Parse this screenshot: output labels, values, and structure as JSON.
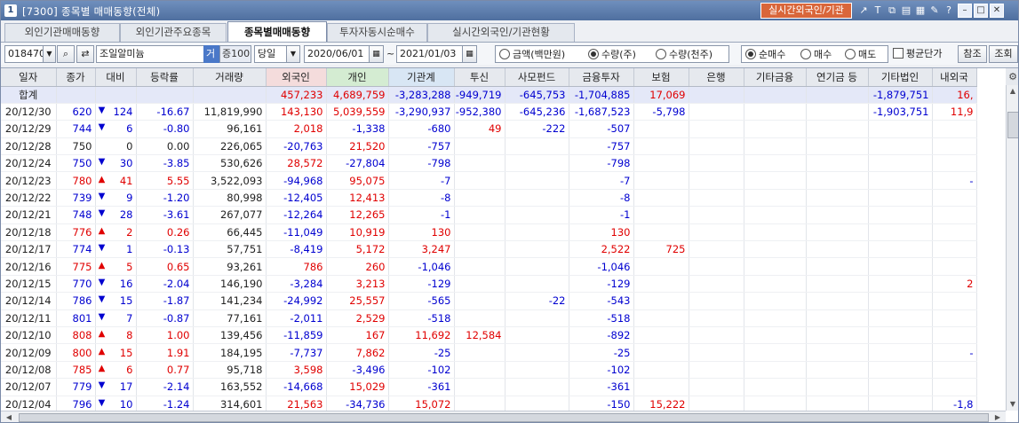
{
  "window": {
    "title": "[7300] 종목별 매매동향(전체)",
    "app_icon": "1",
    "live_button": "실시간외국인/기관"
  },
  "tabs": [
    {
      "label": "외인기관매매동향",
      "active": false
    },
    {
      "label": "외인기관주요종목",
      "active": false
    },
    {
      "label": "종목별매매동향",
      "active": true
    },
    {
      "label": "투자자동시순매수",
      "active": false
    },
    {
      "label": "실시간외국인/기관현황",
      "active": false
    }
  ],
  "toolbar": {
    "code": "018470",
    "stock_name": "조일알미늄",
    "badge_geo": "거",
    "badge_pct": "증100",
    "period": "당일",
    "date_from": "2020/06/01",
    "date_sep": "~",
    "date_to": "2021/01/03",
    "unit_options": [
      "금액(백만원)",
      "수량(주)",
      "수량(천주)"
    ],
    "unit_selected": 1,
    "type_options": [
      "순매수",
      "매수",
      "매도"
    ],
    "type_selected": 0,
    "avg_price_label": "평균단가",
    "ref_button": "참조",
    "query_button": "조회"
  },
  "table": {
    "columns": [
      "일자",
      "종가",
      "대비",
      "등락률",
      "거래량",
      "외국인",
      "개인",
      "기관계",
      "투신",
      "사모펀드",
      "금융투자",
      "보험",
      "은행",
      "기타금융",
      "연기금 등",
      "기타법인",
      "내외국"
    ],
    "summary": {
      "label": "합계",
      "cells": [
        "",
        "",
        "",
        "",
        "457,233",
        "4,689,759",
        "-3,283,288",
        "-949,719",
        "-645,753",
        "-1,704,885",
        "17,069",
        "",
        "",
        "",
        "-1,879,751",
        "16,"
      ]
    },
    "rows": [
      {
        "date": "20/12/30",
        "close": "620",
        "dir": "down",
        "chg": "124",
        "rate": "-16.67",
        "vol": "11,819,990",
        "inv": [
          "143,130",
          "5,039,559",
          "-3,290,937",
          "-952,380",
          "-645,236",
          "-1,687,523",
          "-5,798",
          "",
          "",
          "",
          "-1,903,751",
          "11,9"
        ]
      },
      {
        "date": "20/12/29",
        "close": "744",
        "dir": "down",
        "chg": "6",
        "rate": "-0.80",
        "vol": "96,161",
        "inv": [
          "2,018",
          "-1,338",
          "-680",
          "49",
          "-222",
          "-507",
          "",
          "",
          "",
          "",
          "",
          ""
        ]
      },
      {
        "date": "20/12/28",
        "close": "750",
        "dir": "flat",
        "chg": "0",
        "rate": "0.00",
        "vol": "226,065",
        "inv": [
          "-20,763",
          "21,520",
          "-757",
          "",
          "",
          "-757",
          "",
          "",
          "",
          "",
          "",
          ""
        ]
      },
      {
        "date": "20/12/24",
        "close": "750",
        "dir": "down",
        "chg": "30",
        "rate": "-3.85",
        "vol": "530,626",
        "inv": [
          "28,572",
          "-27,804",
          "-798",
          "",
          "",
          "-798",
          "",
          "",
          "",
          "",
          "",
          ""
        ]
      },
      {
        "date": "20/12/23",
        "close": "780",
        "dir": "up",
        "chg": "41",
        "rate": "5.55",
        "vol": "3,522,093",
        "inv": [
          "-94,968",
          "95,075",
          "-7",
          "",
          "",
          "-7",
          "",
          "",
          "",
          "",
          "",
          "-"
        ]
      },
      {
        "date": "20/12/22",
        "close": "739",
        "dir": "down",
        "chg": "9",
        "rate": "-1.20",
        "vol": "80,998",
        "inv": [
          "-12,405",
          "12,413",
          "-8",
          "",
          "",
          "-8",
          "",
          "",
          "",
          "",
          "",
          ""
        ]
      },
      {
        "date": "20/12/21",
        "close": "748",
        "dir": "down",
        "chg": "28",
        "rate": "-3.61",
        "vol": "267,077",
        "inv": [
          "-12,264",
          "12,265",
          "-1",
          "",
          "",
          "-1",
          "",
          "",
          "",
          "",
          "",
          ""
        ]
      },
      {
        "date": "20/12/18",
        "close": "776",
        "dir": "up",
        "chg": "2",
        "rate": "0.26",
        "vol": "66,445",
        "inv": [
          "-11,049",
          "10,919",
          "130",
          "",
          "",
          "130",
          "",
          "",
          "",
          "",
          "",
          ""
        ]
      },
      {
        "date": "20/12/17",
        "close": "774",
        "dir": "down",
        "chg": "1",
        "rate": "-0.13",
        "vol": "57,751",
        "inv": [
          "-8,419",
          "5,172",
          "3,247",
          "",
          "",
          "2,522",
          "725",
          "",
          "",
          "",
          "",
          ""
        ]
      },
      {
        "date": "20/12/16",
        "close": "775",
        "dir": "up",
        "chg": "5",
        "rate": "0.65",
        "vol": "93,261",
        "inv": [
          "786",
          "260",
          "-1,046",
          "",
          "",
          "-1,046",
          "",
          "",
          "",
          "",
          "",
          ""
        ]
      },
      {
        "date": "20/12/15",
        "close": "770",
        "dir": "down",
        "chg": "16",
        "rate": "-2.04",
        "vol": "146,190",
        "inv": [
          "-3,284",
          "3,213",
          "-129",
          "",
          "",
          "-129",
          "",
          "",
          "",
          "",
          "",
          "2"
        ]
      },
      {
        "date": "20/12/14",
        "close": "786",
        "dir": "down",
        "chg": "15",
        "rate": "-1.87",
        "vol": "141,234",
        "inv": [
          "-24,992",
          "25,557",
          "-565",
          "",
          "-22",
          "-543",
          "",
          "",
          "",
          "",
          "",
          ""
        ]
      },
      {
        "date": "20/12/11",
        "close": "801",
        "dir": "down",
        "chg": "7",
        "rate": "-0.87",
        "vol": "77,161",
        "inv": [
          "-2,011",
          "2,529",
          "-518",
          "",
          "",
          "-518",
          "",
          "",
          "",
          "",
          "",
          ""
        ]
      },
      {
        "date": "20/12/10",
        "close": "808",
        "dir": "up",
        "chg": "8",
        "rate": "1.00",
        "vol": "139,456",
        "inv": [
          "-11,859",
          "167",
          "11,692",
          "12,584",
          "",
          "-892",
          "",
          "",
          "",
          "",
          "",
          ""
        ]
      },
      {
        "date": "20/12/09",
        "close": "800",
        "dir": "up",
        "chg": "15",
        "rate": "1.91",
        "vol": "184,195",
        "inv": [
          "-7,737",
          "7,862",
          "-25",
          "",
          "",
          "-25",
          "",
          "",
          "",
          "",
          "",
          "-"
        ]
      },
      {
        "date": "20/12/08",
        "close": "785",
        "dir": "up",
        "chg": "6",
        "rate": "0.77",
        "vol": "95,718",
        "inv": [
          "3,598",
          "-3,496",
          "-102",
          "",
          "",
          "-102",
          "",
          "",
          "",
          "",
          "",
          ""
        ]
      },
      {
        "date": "20/12/07",
        "close": "779",
        "dir": "down",
        "chg": "17",
        "rate": "-2.14",
        "vol": "163,552",
        "inv": [
          "-14,668",
          "15,029",
          "-361",
          "",
          "",
          "-361",
          "",
          "",
          "",
          "",
          "",
          ""
        ]
      },
      {
        "date": "20/12/04",
        "close": "796",
        "dir": "down",
        "chg": "10",
        "rate": "-1.24",
        "vol": "314,601",
        "inv": [
          "21,563",
          "-34,736",
          "15,072",
          "",
          "",
          "-150",
          "15,222",
          "",
          "",
          "",
          "",
          "-1,8"
        ]
      }
    ]
  },
  "colors": {
    "up": "#e00000",
    "down": "#0000d0",
    "summary_bg": "#e4e8f8",
    "foreign_header": "#f4dcdc",
    "individual_header": "#d4ecd2",
    "institution_header": "#d8e6f4"
  }
}
